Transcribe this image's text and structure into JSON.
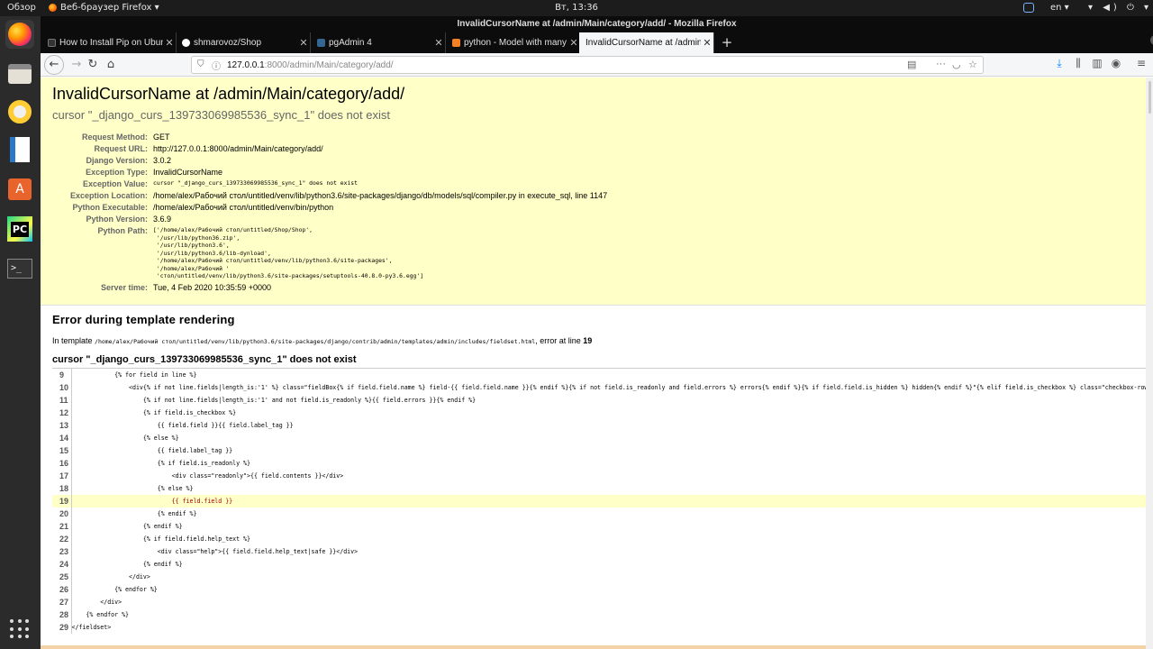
{
  "system": {
    "overview": "Обзор",
    "app_menu": "Веб-браузер Firefox ▾",
    "clock": "Вт, 13:36",
    "lang": "en ▾",
    "status_icons": "▾ ◀) ⏻ ▾"
  },
  "window": {
    "title": "InvalidCursorName at /admin/Main/category/add/ - Mozilla Firefox"
  },
  "tabs": [
    {
      "label": "How to Install Pip on Ubuntu",
      "icon": "github-like-icon"
    },
    {
      "label": "shmarovoz/Shop",
      "icon": "github-icon"
    },
    {
      "label": "pgAdmin 4",
      "icon": "pgadmin-icon"
    },
    {
      "label": "python - Model with many",
      "icon": "stackoverflow-icon"
    },
    {
      "label": "InvalidCursorName at /admin",
      "icon": "",
      "active": true
    }
  ],
  "urlbar": {
    "host": "127.0.0.1",
    "rest": ":8000/admin/Main/category/add/"
  },
  "error": {
    "title": "InvalidCursorName at /admin/Main/category/add/",
    "subtitle": "cursor \"_django_curs_139733069985536_sync_1\" does not exist",
    "meta": [
      {
        "label": "Request Method:",
        "value": "GET"
      },
      {
        "label": "Request URL:",
        "value": "http://127.0.0.1:8000/admin/Main/category/add/"
      },
      {
        "label": "Django Version:",
        "value": "3.0.2"
      },
      {
        "label": "Exception Type:",
        "value": "InvalidCursorName"
      },
      {
        "label": "Exception Value:",
        "value": "cursor \"_django_curs_139733069985536_sync_1\" does not exist"
      },
      {
        "label": "Exception Location:",
        "value": "/home/alex/Рабочий стол/untitled/venv/lib/python3.6/site-packages/django/db/models/sql/compiler.py in execute_sql, line 1147"
      },
      {
        "label": "Python Executable:",
        "value": "/home/alex/Рабочий стол/untitled/venv/bin/python"
      },
      {
        "label": "Python Version:",
        "value": "3.6.9"
      },
      {
        "label": "Python Path:",
        "value": "['/home/alex/Рабочий стол/untitled/Shop/Shop',\n '/usr/lib/python36.zip',\n '/usr/lib/python3.6',\n '/usr/lib/python3.6/lib-dynload',\n '/home/alex/Рабочий стол/untitled/venv/lib/python3.6/site-packages',\n '/home/alex/Рабочий '\n 'стол/untitled/venv/lib/python3.6/site-packages/setuptools-40.8.0-py3.6.egg']"
      },
      {
        "label": "Server time:",
        "value": "Tue, 4 Feb 2020 10:35:59 +0000"
      }
    ]
  },
  "template_error": {
    "heading": "Error during template rendering",
    "in_prefix": "In template ",
    "path": "/home/alex/Рабочий стол/untitled/venv/lib/python3.6/site-packages/django/contrib/admin/templates/admin/includes/fieldset.html",
    "at_line": ", error at line ",
    "line": "19",
    "message": "cursor \"_django_curs_139733069985536_sync_1\" does not exist",
    "source": [
      {
        "n": "9",
        "code": "            {% for field in line %}"
      },
      {
        "n": "10",
        "code": "                <div{% if not line.fields|length_is:'1' %} class=\"fieldBox{% if field.field.name %} field-{{ field.field.name }}{% endif %}{% if not field.is_readonly and field.errors %} errors{% endif %}{% if field.field.is_hidden %} hidden{% endif %}\"{% elif field.is_checkbox %} class=\"checkbox-row\"{% endif %}>"
      },
      {
        "n": "11",
        "code": "                    {% if not line.fields|length_is:'1' and not field.is_readonly %}{{ field.errors }}{% endif %}"
      },
      {
        "n": "12",
        "code": "                    {% if field.is_checkbox %}"
      },
      {
        "n": "13",
        "code": "                        {{ field.field }}{{ field.label_tag }}"
      },
      {
        "n": "14",
        "code": "                    {% else %}"
      },
      {
        "n": "15",
        "code": "                        {{ field.label_tag }}"
      },
      {
        "n": "16",
        "code": "                        {% if field.is_readonly %}"
      },
      {
        "n": "17",
        "code": "                            <div class=\"readonly\">{{ field.contents }}</div>"
      },
      {
        "n": "18",
        "code": "                        {% else %}"
      },
      {
        "n": "19",
        "code": "                            {{ field.field }}",
        "hl": true
      },
      {
        "n": "20",
        "code": "                        {% endif %}"
      },
      {
        "n": "21",
        "code": "                    {% endif %}"
      },
      {
        "n": "22",
        "code": "                    {% if field.field.help_text %}"
      },
      {
        "n": "23",
        "code": "                        <div class=\"help\">{{ field.field.help_text|safe }}</div>"
      },
      {
        "n": "24",
        "code": "                    {% endif %}"
      },
      {
        "n": "25",
        "code": "                </div>"
      },
      {
        "n": "26",
        "code": "            {% endfor %}"
      },
      {
        "n": "27",
        "code": "        </div>"
      },
      {
        "n": "28",
        "code": "    {% endfor %}"
      },
      {
        "n": "29",
        "code": "</fieldset>"
      }
    ]
  }
}
